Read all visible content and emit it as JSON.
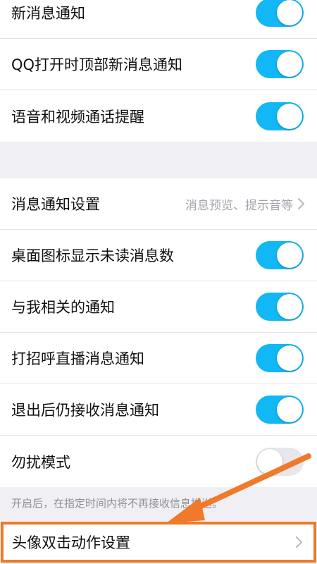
{
  "group1": {
    "rows": [
      {
        "label": "新消息通知",
        "toggle": "on"
      },
      {
        "label": "QQ打开时顶部新消息通知",
        "toggle": "on"
      },
      {
        "label": "语音和视频通话提醒",
        "toggle": "on"
      }
    ]
  },
  "group2": {
    "notification_settings": {
      "label": "消息通知设置",
      "detail": "消息预览、提示音等"
    },
    "rows": [
      {
        "label": "桌面图标显示未读消息数",
        "toggle": "on"
      },
      {
        "label": "与我相关的通知",
        "toggle": "on"
      },
      {
        "label": "打招呼直播消息通知",
        "toggle": "on"
      },
      {
        "label": "退出后仍接收消息通知",
        "toggle": "on"
      },
      {
        "label": "勿扰模式",
        "toggle": "off"
      }
    ]
  },
  "dnd_hint": "开启后，在指定时间内将不再接收信息推送。",
  "avatar_double_tap": {
    "label": "头像双击动作设置"
  },
  "colors": {
    "toggle_on": "#12b7f5",
    "toggle_off": "#e7e7ec",
    "highlight": "#f07a2a",
    "background": "#f0f0f4"
  }
}
